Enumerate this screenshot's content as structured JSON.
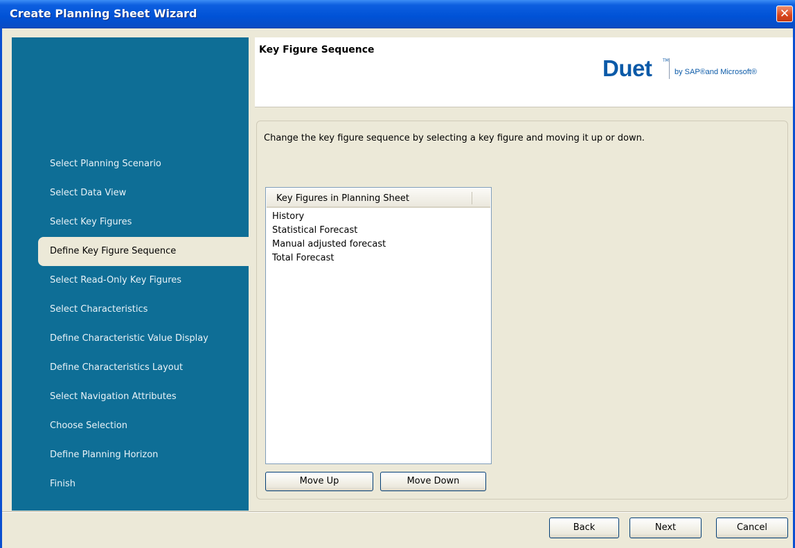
{
  "window": {
    "title": "Create Planning Sheet Wizard",
    "close_glyph": "✕"
  },
  "sidebar": {
    "items": [
      {
        "label": "Select Planning Scenario",
        "active": false
      },
      {
        "label": "Select Data View",
        "active": false
      },
      {
        "label": "Select Key Figures",
        "active": false
      },
      {
        "label": "Define Key Figure Sequence",
        "active": true
      },
      {
        "label": "Select Read-Only Key Figures",
        "active": false
      },
      {
        "label": "Select Characteristics",
        "active": false
      },
      {
        "label": "Define Characteristic Value Display",
        "active": false
      },
      {
        "label": "Define Characteristics Layout",
        "active": false
      },
      {
        "label": "Select Navigation Attributes",
        "active": false
      },
      {
        "label": "Choose Selection",
        "active": false
      },
      {
        "label": "Define Planning Horizon",
        "active": false
      },
      {
        "label": "Finish",
        "active": false
      }
    ]
  },
  "header": {
    "title": "Key Figure Sequence",
    "logo": {
      "word": "Duet",
      "tm": "TM",
      "tagline": "by SAP®and Microsoft®",
      "color": "#0b5aa8"
    }
  },
  "main": {
    "instruction": "Change the key figure sequence by selecting a key figure and moving it up or down.",
    "list": {
      "column_header": "Key Figures in Planning Sheet",
      "items": [
        "History",
        "Statistical Forecast",
        "Manual adjusted forecast",
        "Total Forecast"
      ]
    },
    "move_up_label": "Move Up",
    "move_down_label": "Move Down"
  },
  "footer": {
    "back_label": "Back",
    "next_label": "Next",
    "cancel_label": "Cancel"
  },
  "colors": {
    "sidebar_bg": "#0e6e96",
    "window_bg": "#ece9d8",
    "titlebar": "#0052d6"
  }
}
